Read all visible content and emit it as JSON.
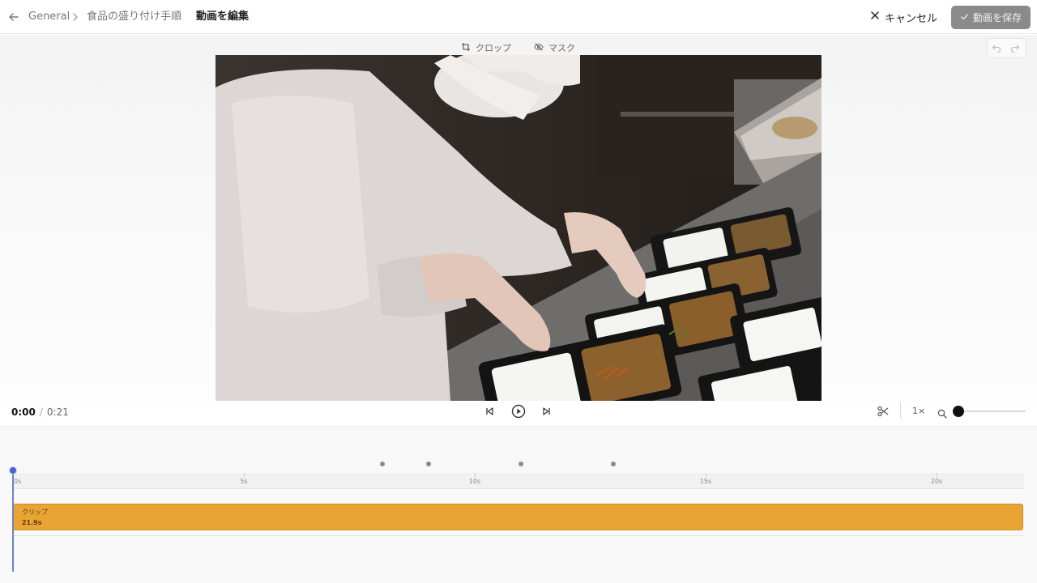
{
  "header": {
    "breadcrumb_root": "General",
    "breadcrumb_item": "食品の盛り付け手順",
    "current": "動画を編集",
    "cancel_label": "キャンセル",
    "save_label": "動画を保存"
  },
  "toolbar": {
    "crop_label": "クロップ",
    "mask_label": "マスク"
  },
  "player": {
    "current_time": "0:00",
    "separator": "/",
    "duration": "0:21",
    "speed": "1×",
    "zoom_level": 0
  },
  "timeline": {
    "ticks": [
      "0s",
      "5s",
      "10s",
      "15s",
      "20s"
    ],
    "markers_seconds": [
      8,
      9,
      11,
      13
    ],
    "clip": {
      "name": "クリップ",
      "length": "21.9s"
    },
    "playhead_seconds": 0
  },
  "colors": {
    "clip": "#eaa435",
    "playhead": "#4d63d6",
    "save_button": "#8a8a8a"
  },
  "icons": [
    "back-arrow-icon",
    "chevron-right-icon",
    "close-icon",
    "check-icon",
    "crop-icon",
    "eye-off-icon",
    "undo-icon",
    "redo-icon",
    "skip-back-icon",
    "play-icon",
    "skip-forward-icon",
    "scissors-icon",
    "search-icon"
  ]
}
